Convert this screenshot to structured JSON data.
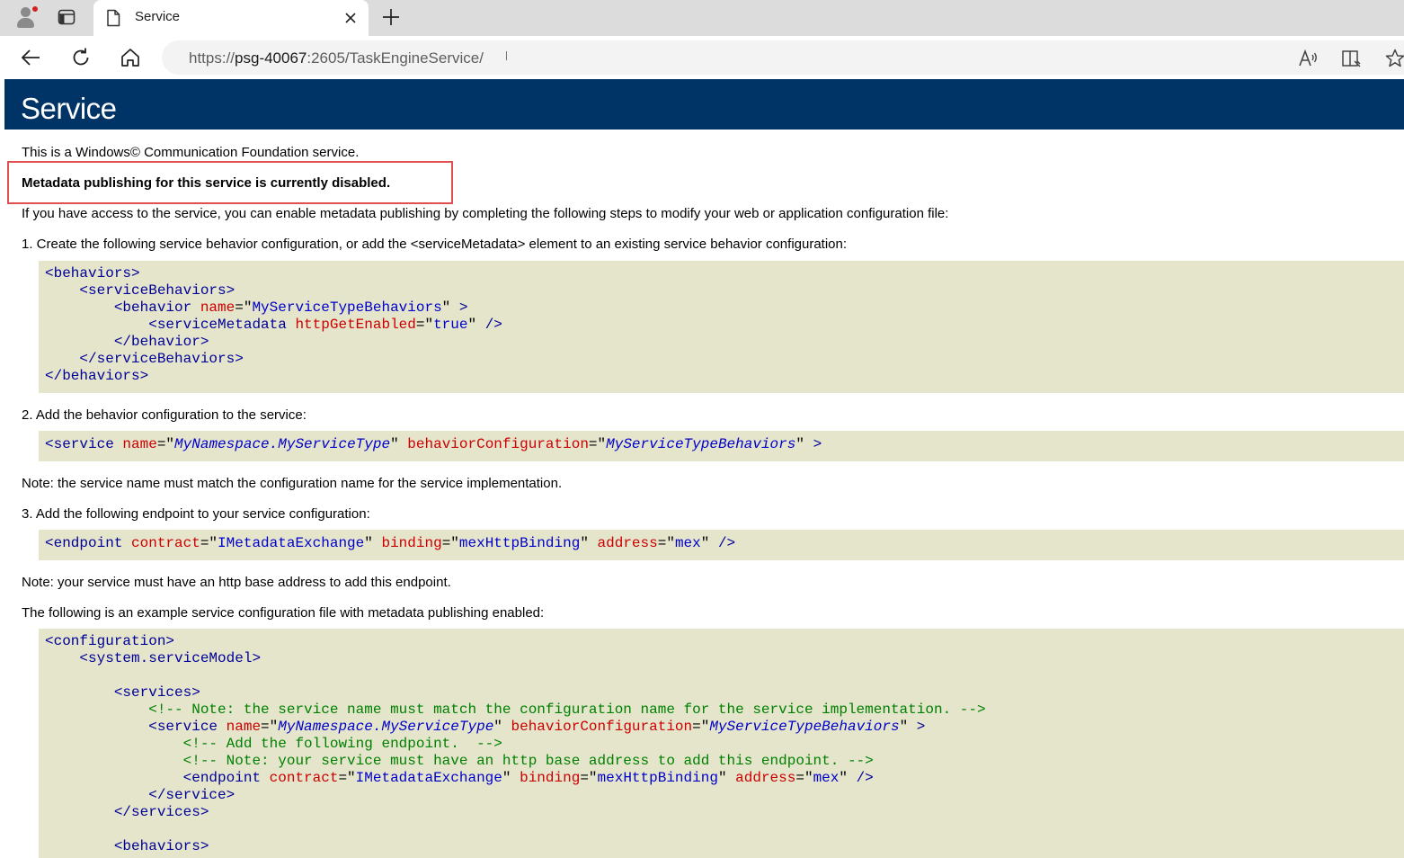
{
  "browser": {
    "tab_title": "Service",
    "url_prefix": "https://",
    "url_host": "psg-40067",
    "url_rest": ":2605/TaskEngineService/"
  },
  "page": {
    "heading": "Service",
    "intro": "This is a Windows© Communication Foundation service.",
    "disabled_notice": "Metadata publishing for this service is currently disabled.",
    "access_text": "If you have access to the service, you can enable metadata publishing by completing the following steps to modify your web or application configuration file:",
    "step1": "1. Create the following service behavior configuration, or add the <serviceMetadata> element to an existing service behavior configuration:",
    "step2": "2. Add the behavior configuration to the service:",
    "note1": "Note: the service name must match the configuration name for the service implementation.",
    "step3": "3. Add the following endpoint to your service configuration:",
    "note2": "Note: your service must have an http base address to add this endpoint.",
    "example_intro": "The following is an example service configuration file with metadata publishing enabled:"
  },
  "code1": [
    [
      [
        "tg",
        "<behaviors>"
      ]
    ],
    [
      [
        "tx",
        "    "
      ],
      [
        "tg",
        "<serviceBehaviors>"
      ]
    ],
    [
      [
        "tx",
        "        "
      ],
      [
        "tg",
        "<behavior "
      ],
      [
        "at",
        "name"
      ],
      [
        "tx",
        "=\""
      ],
      [
        "vl",
        "MyServiceTypeBehaviors"
      ],
      [
        "tx",
        "\" "
      ],
      [
        "tg",
        ">"
      ]
    ],
    [
      [
        "tx",
        "            "
      ],
      [
        "tg",
        "<serviceMetadata "
      ],
      [
        "at",
        "httpGetEnabled"
      ],
      [
        "tx",
        "=\""
      ],
      [
        "vl",
        "true"
      ],
      [
        "tx",
        "\" "
      ],
      [
        "tg",
        "/>"
      ]
    ],
    [
      [
        "tx",
        "        "
      ],
      [
        "tg",
        "</behavior>"
      ]
    ],
    [
      [
        "tx",
        "    "
      ],
      [
        "tg",
        "</serviceBehaviors>"
      ]
    ],
    [
      [
        "tg",
        "</behaviors>"
      ]
    ]
  ],
  "code2": [
    [
      [
        "tg",
        "<service "
      ],
      [
        "at",
        "name"
      ],
      [
        "tx",
        "=\""
      ],
      [
        "vi",
        "MyNamespace.MyServiceType"
      ],
      [
        "tx",
        "\" "
      ],
      [
        "at",
        "behaviorConfiguration"
      ],
      [
        "tx",
        "=\""
      ],
      [
        "vi",
        "MyServiceTypeBehaviors"
      ],
      [
        "tx",
        "\" "
      ],
      [
        "tg",
        ">"
      ]
    ]
  ],
  "code3": [
    [
      [
        "tg",
        "<endpoint "
      ],
      [
        "at",
        "contract"
      ],
      [
        "tx",
        "=\""
      ],
      [
        "vl",
        "IMetadataExchange"
      ],
      [
        "tx",
        "\" "
      ],
      [
        "at",
        "binding"
      ],
      [
        "tx",
        "=\""
      ],
      [
        "vl",
        "mexHttpBinding"
      ],
      [
        "tx",
        "\" "
      ],
      [
        "at",
        "address"
      ],
      [
        "tx",
        "=\""
      ],
      [
        "vl",
        "mex"
      ],
      [
        "tx",
        "\" "
      ],
      [
        "tg",
        "/>"
      ]
    ]
  ],
  "code4": [
    [
      [
        "tg",
        "<configuration>"
      ]
    ],
    [
      [
        "tx",
        "    "
      ],
      [
        "tg",
        "<system.serviceModel>"
      ]
    ],
    [
      [
        "tx",
        ""
      ]
    ],
    [
      [
        "tx",
        "        "
      ],
      [
        "tg",
        "<services>"
      ]
    ],
    [
      [
        "tx",
        "            "
      ],
      [
        "cm",
        "<!-- Note: the service name must match the configuration name for the service implementation. -->"
      ]
    ],
    [
      [
        "tx",
        "            "
      ],
      [
        "tg",
        "<service "
      ],
      [
        "at",
        "name"
      ],
      [
        "tx",
        "=\""
      ],
      [
        "vi",
        "MyNamespace.MyServiceType"
      ],
      [
        "tx",
        "\" "
      ],
      [
        "at",
        "behaviorConfiguration"
      ],
      [
        "tx",
        "=\""
      ],
      [
        "vi",
        "MyServiceTypeBehaviors"
      ],
      [
        "tx",
        "\" "
      ],
      [
        "tg",
        ">"
      ]
    ],
    [
      [
        "tx",
        "                "
      ],
      [
        "cm",
        "<!-- Add the following endpoint.  -->"
      ]
    ],
    [
      [
        "tx",
        "                "
      ],
      [
        "cm",
        "<!-- Note: your service must have an http base address to add this endpoint. -->"
      ]
    ],
    [
      [
        "tx",
        "                "
      ],
      [
        "tg",
        "<endpoint "
      ],
      [
        "at",
        "contract"
      ],
      [
        "tx",
        "=\""
      ],
      [
        "vl",
        "IMetadataExchange"
      ],
      [
        "tx",
        "\" "
      ],
      [
        "at",
        "binding"
      ],
      [
        "tx",
        "=\""
      ],
      [
        "vl",
        "mexHttpBinding"
      ],
      [
        "tx",
        "\" "
      ],
      [
        "at",
        "address"
      ],
      [
        "tx",
        "=\""
      ],
      [
        "vl",
        "mex"
      ],
      [
        "tx",
        "\" "
      ],
      [
        "tg",
        "/>"
      ]
    ],
    [
      [
        "tx",
        "            "
      ],
      [
        "tg",
        "</service>"
      ]
    ],
    [
      [
        "tx",
        "        "
      ],
      [
        "tg",
        "</services>"
      ]
    ],
    [
      [
        "tx",
        ""
      ]
    ],
    [
      [
        "tx",
        "        "
      ],
      [
        "tg",
        "<behaviors>"
      ]
    ]
  ]
}
